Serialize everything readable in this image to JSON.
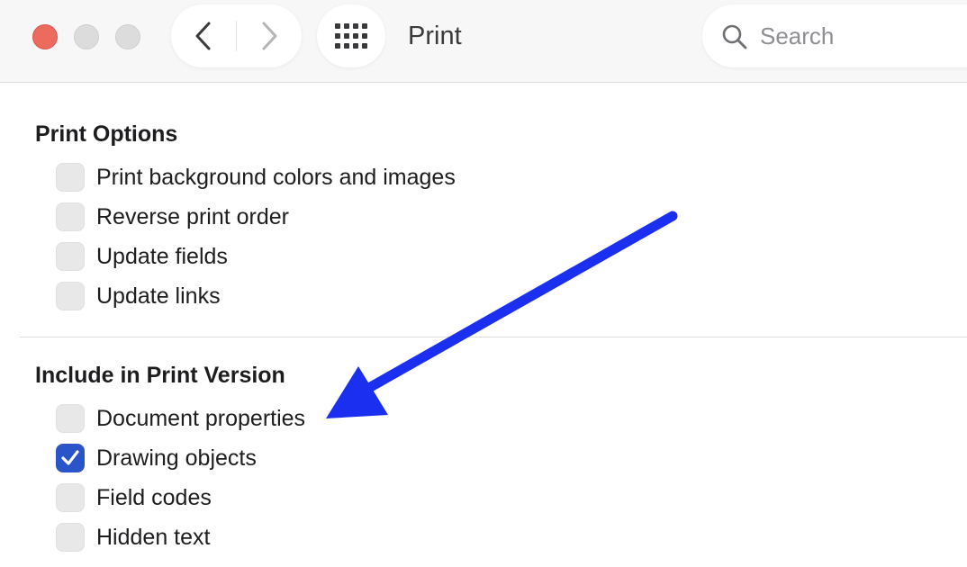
{
  "window": {
    "title": "Print",
    "buttons": {
      "close": "close",
      "minimize": "minimize",
      "zoom": "zoom"
    }
  },
  "toolbar": {
    "back_icon": "chevron-left-icon",
    "forward_icon": "chevron-right-icon",
    "grid_icon": "grid-icon",
    "search": {
      "placeholder": "Search",
      "value": "",
      "icon": "search-icon"
    }
  },
  "print_options": {
    "title": "Print Options",
    "items": [
      {
        "label": "Print background colors and images",
        "checked": false
      },
      {
        "label": "Reverse print order",
        "checked": false
      },
      {
        "label": "Update fields",
        "checked": false
      },
      {
        "label": "Update links",
        "checked": false
      }
    ]
  },
  "include_in_print": {
    "title": "Include in Print Version",
    "items": [
      {
        "label": "Document properties",
        "checked": false
      },
      {
        "label": "Drawing objects",
        "checked": true
      },
      {
        "label": "Field codes",
        "checked": false
      },
      {
        "label": "Hidden text",
        "checked": false
      }
    ]
  },
  "annotation": {
    "type": "arrow",
    "color": "#1a2ff0",
    "points_to": "Document properties"
  },
  "colors": {
    "accent": "#2a55c9",
    "close": "#ed6a5e",
    "arrow": "#1a2ff0"
  }
}
